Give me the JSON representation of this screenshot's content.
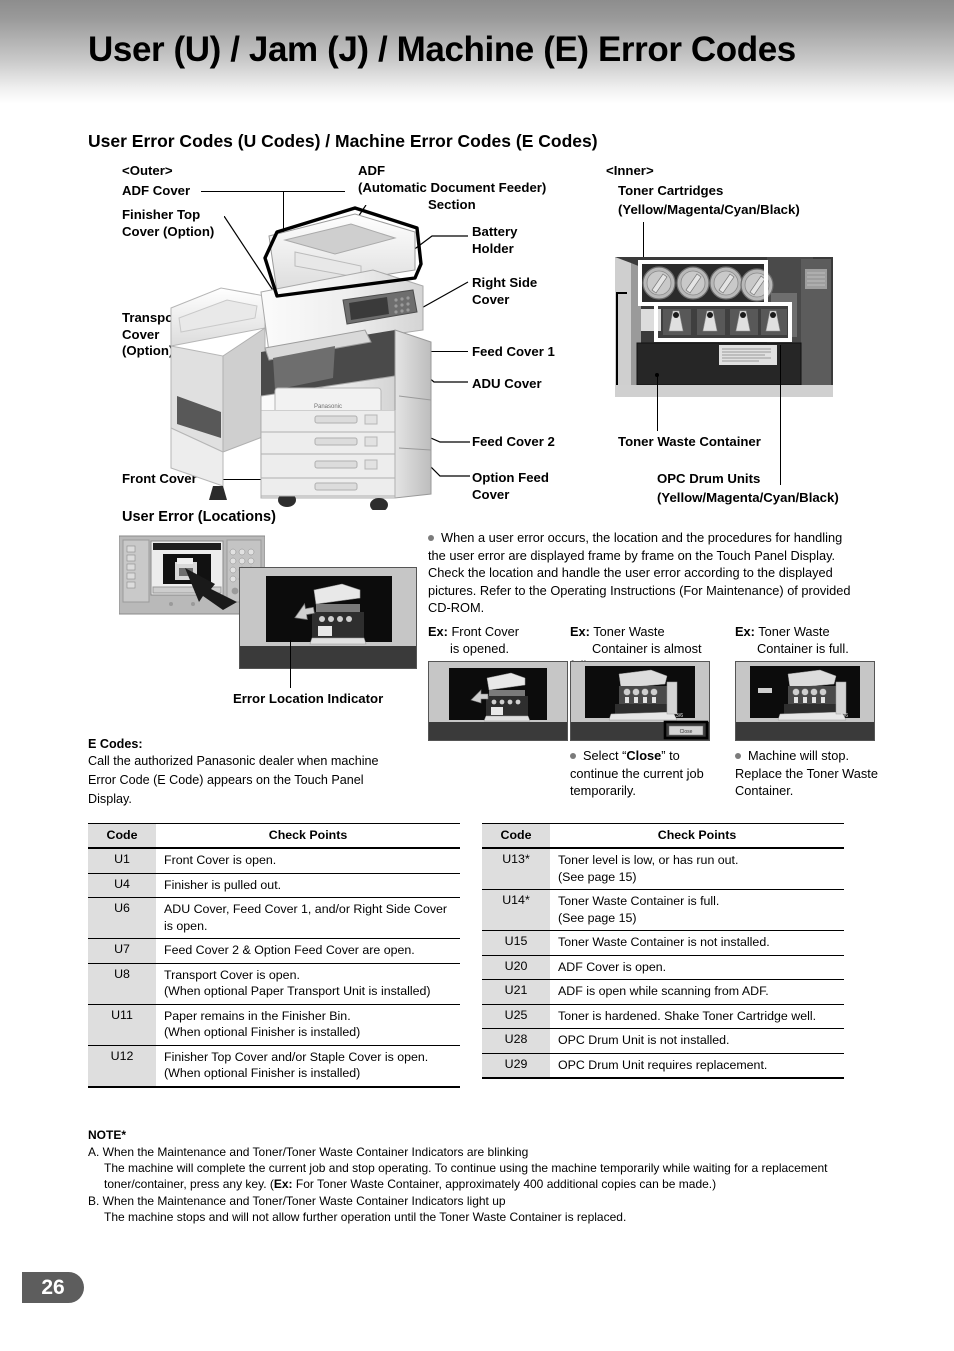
{
  "header": {
    "title": "User (U) / Jam (J) / Machine (E) Error Codes"
  },
  "section": {
    "heading": "User Error Codes (U Codes) / Machine Error Codes (E Codes)"
  },
  "diagram_outer": {
    "group_label": "<Outer>",
    "labels": {
      "adf_cover": "ADF Cover",
      "finisher_top_cover": "Finisher Top\nCover (Option)",
      "transport_cover": "Transport\nCover\n(Option)",
      "front_cover": "Front Cover",
      "adf_section_l1": "ADF",
      "adf_section_l2": "(Automatic Document Feeder)",
      "adf_section_l3": "Section",
      "battery_holder": "Battery\nHolder",
      "right_side_cover": "Right Side\nCover",
      "feed_cover_1": "Feed Cover 1",
      "adu_cover": "ADU Cover",
      "feed_cover_2": "Feed Cover 2",
      "option_feed_cover": "Option Feed\nCover"
    },
    "brand_on_photo": "Panasonic"
  },
  "diagram_inner": {
    "group_label": "<Inner>",
    "labels": {
      "toner_cartridges_l1": "Toner Cartridges",
      "toner_cartridges_l2": "(Yellow/Magenta/Cyan/Black)",
      "toner_waste_container": "Toner Waste Container",
      "opc_drum_units_l1": "OPC Drum Units",
      "opc_drum_units_l2": "(Yellow/Magenta/Cyan/Black)"
    }
  },
  "user_error": {
    "heading": "User Error (Locations)",
    "indicator_label": "Error Location Indicator",
    "description": "When a user error occurs, the location and the procedures for handling the user error are displayed frame by frame on the Touch Panel Display. Check the location and handle the user error according to the displayed pictures. Refer to the Operating Instructions (For Maintenance) of provided CD-ROM.",
    "examples": [
      {
        "ex_label": "Ex:",
        "caption_l1": "Front Cover",
        "caption_l2": "is opened.",
        "note": "",
        "screen_counter": ""
      },
      {
        "ex_label": "Ex:",
        "caption_l1": "Toner Waste",
        "caption_l2": "Container is almost full.",
        "note_pre": "Select “",
        "note_bold": "Close",
        "note_post": "” to continue the current job temporarily.",
        "screen_counter": "3/6",
        "screen_button": "Close"
      },
      {
        "ex_label": "Ex:",
        "caption_l1": "Toner Waste",
        "caption_l2": "Container is full.",
        "note": "Machine will stop. Replace the Toner Waste Container.",
        "screen_counter": "5/6"
      }
    ]
  },
  "ecodes": {
    "title": "E Codes:",
    "body": "Call the authorized Panasonic dealer when machine Error Code (E Code) appears on the Touch Panel Display."
  },
  "table_left": {
    "headers": [
      "Code",
      "Check Points"
    ],
    "rows": [
      {
        "code": "U1",
        "check": "Front Cover is open."
      },
      {
        "code": "U4",
        "check": "Finisher is pulled out."
      },
      {
        "code": "U6",
        "check": "ADU Cover, Feed Cover 1, and/or Right Side Cover is open."
      },
      {
        "code": "U7",
        "check": "Feed Cover 2 & Option Feed Cover are open."
      },
      {
        "code": "U8",
        "check": "Transport Cover is open.\n(When optional Paper Transport Unit is installed)"
      },
      {
        "code": "U11",
        "check": "Paper remains in the Finisher Bin.\n(When optional Finisher is installed)"
      },
      {
        "code": "U12",
        "check": "Finisher Top Cover and/or Staple Cover is open.\n(When optional Finisher is installed)"
      }
    ]
  },
  "table_right": {
    "headers": [
      "Code",
      "Check Points"
    ],
    "rows": [
      {
        "code": "U13*",
        "check": "Toner level is low, or has run out.\n(See page 15)"
      },
      {
        "code": "U14*",
        "check": "Toner Waste Container is full.\n(See page 15)"
      },
      {
        "code": "U15",
        "check": "Toner Waste Container is not installed."
      },
      {
        "code": "U20",
        "check": "ADF Cover is open."
      },
      {
        "code": "U21",
        "check": "ADF is open while scanning from ADF."
      },
      {
        "code": "U25",
        "check": "Toner is hardened. Shake Toner Cartridge well."
      },
      {
        "code": "U28",
        "check": "OPC Drum Unit is not installed."
      },
      {
        "code": "U29",
        "check": "OPC Drum Unit requires replacement."
      }
    ]
  },
  "notes": {
    "title": "NOTE*",
    "items": [
      {
        "head": "A. When the Maintenance and Toner/Toner Waste Container Indicators are blinking",
        "body_pre": "The machine will complete the current job and stop operating. To continue using the machine temporarily while waiting for a replacement toner/container, press any key. (",
        "body_bold": "Ex:",
        "body_post": " For Toner Waste Container, approximately 400 additional copies can be made.)"
      },
      {
        "head": "B. When the Maintenance and Toner/Toner Waste Container Indicators light up",
        "body_pre": "The machine stops and will not allow further operation until the Toner Waste Container is replaced.",
        "body_bold": "",
        "body_post": ""
      }
    ]
  },
  "footer": {
    "page_number": "26"
  }
}
